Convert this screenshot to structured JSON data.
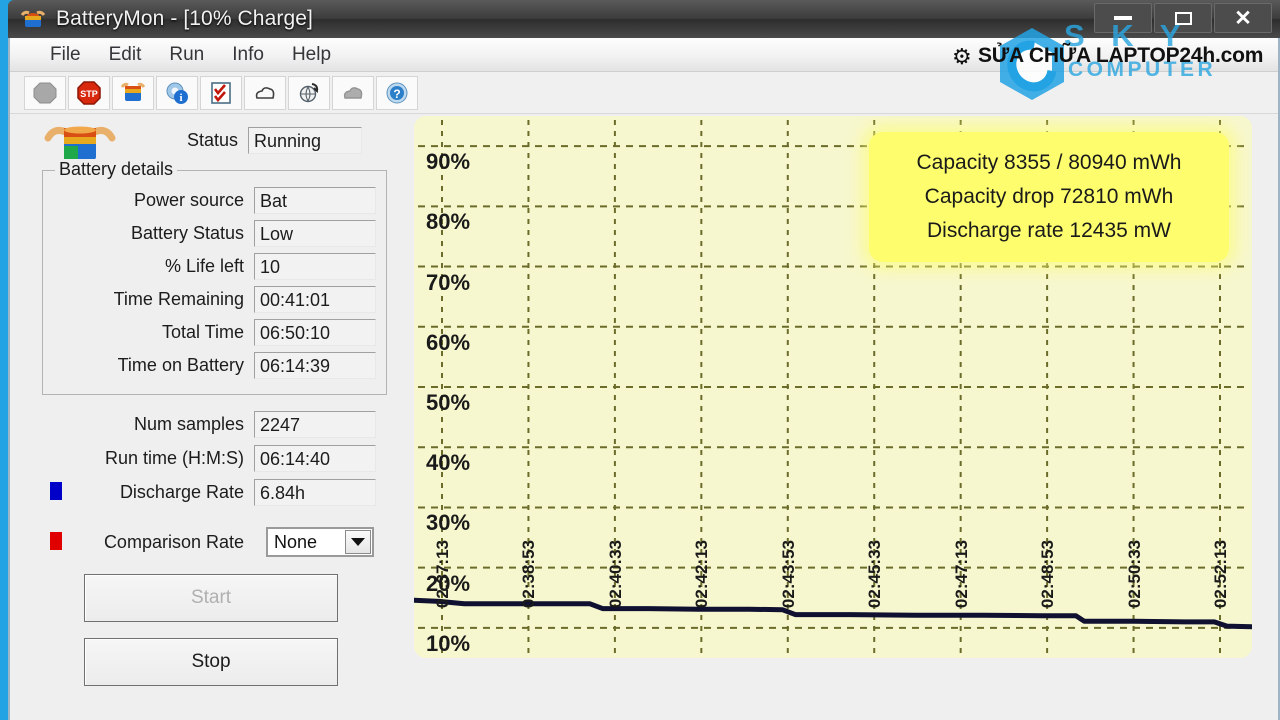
{
  "window": {
    "title": "BatteryMon - [10% Charge]",
    "app_icon": "battery-flex-icon",
    "minimize_label": "Minimize",
    "maximize_label": "Maximize",
    "close_label": "Close"
  },
  "watermark": {
    "gear_icon": "gear-icon",
    "text": "SỬA CHỮA LAPTOP24h.com",
    "sky": "S K Y",
    "computer": "COMPUTER"
  },
  "menu": {
    "items": [
      {
        "label": "File"
      },
      {
        "label": "Edit"
      },
      {
        "label": "Run"
      },
      {
        "label": "Info"
      },
      {
        "label": "Help"
      }
    ]
  },
  "toolbar": {
    "buttons": [
      {
        "icon": "record-stop-gray-icon",
        "title": "Stop recording"
      },
      {
        "icon": "stop-sign-red-icon",
        "title": "Stop"
      },
      {
        "icon": "battery-color-icon",
        "title": "Battery"
      },
      {
        "icon": "gear-info-icon",
        "title": "Settings info"
      },
      {
        "icon": "checklist-icon",
        "title": "Checklist"
      },
      {
        "icon": "cloud-icon",
        "title": "Upload"
      },
      {
        "icon": "globe-arrow-icon",
        "title": "Refresh"
      },
      {
        "icon": "cloud-gray-icon",
        "title": "Cloud disabled"
      },
      {
        "icon": "help-blue-icon",
        "title": "Help"
      }
    ]
  },
  "status": {
    "label": "Status",
    "value": "Running"
  },
  "battery_details": {
    "group_title": "Battery details",
    "rows": [
      {
        "label": "Power source",
        "value": "Bat"
      },
      {
        "label": "Battery Status",
        "value": "Low"
      },
      {
        "label": "% Life left",
        "value": "10"
      },
      {
        "label": "Time Remaining",
        "value": "00:41:01"
      },
      {
        "label": "Total Time",
        "value": "06:50:10"
      },
      {
        "label": "Time on Battery",
        "value": "06:14:39"
      }
    ]
  },
  "stats": {
    "rows": [
      {
        "label": "Num samples",
        "value": "2247",
        "swatch": null
      },
      {
        "label": "Run time (H:M:S)",
        "value": "06:14:40",
        "swatch": null
      },
      {
        "label": "Discharge Rate",
        "value": "6.84h",
        "swatch": "#0000c8"
      },
      {
        "label": "Comparison Rate",
        "value": "None",
        "swatch": "#e00000",
        "is_combo": true
      }
    ]
  },
  "buttons": {
    "start": "Start",
    "stop": "Stop"
  },
  "chart_info": {
    "capacity": "Capacity 8355 / 80940 mWh",
    "capacity_drop": "Capacity drop 72810 mWh",
    "discharge_rate": "Discharge rate 12435 mW"
  },
  "colors": {
    "chart_bg": "#f7f7cf",
    "grid": "#6b6b2a",
    "info_bg": "#fdfd6e",
    "discharge_line": "#101030",
    "comparison": "#e00000",
    "accent_blue": "#23a3e3"
  },
  "chart_data": {
    "type": "line",
    "title": "",
    "xlabel": "",
    "ylabel": "",
    "ylim": [
      5,
      95
    ],
    "grid": true,
    "ytick_labels": [
      "90%",
      "80%",
      "70%",
      "60%",
      "50%",
      "40%",
      "30%",
      "20%",
      "10%"
    ],
    "ytick_values": [
      90,
      80,
      70,
      60,
      50,
      40,
      30,
      20,
      10
    ],
    "xtick_labels": [
      "02:37:13",
      "02:38:53",
      "02:40:33",
      "02:42:13",
      "02:43:53",
      "02:45:33",
      "02:47:13",
      "02:48:53",
      "02:50:33",
      "02:52:13"
    ],
    "series": [
      {
        "name": "Discharge Rate",
        "color": "#101030",
        "x": [
          0,
          0.03,
          0.06,
          0.14,
          0.21,
          0.225,
          0.28,
          0.34,
          0.4,
          0.44,
          0.455,
          0.52,
          0.6,
          0.68,
          0.75,
          0.79,
          0.8,
          0.86,
          0.92,
          0.955,
          0.97,
          1.0
        ],
        "values": [
          14.6,
          14.4,
          14.0,
          14.0,
          14.0,
          13.2,
          13.2,
          13.1,
          13.1,
          13.0,
          12.2,
          12.2,
          12.1,
          12.1,
          12.0,
          12.0,
          11.1,
          11.1,
          11.0,
          11.0,
          10.3,
          10.2
        ]
      }
    ]
  }
}
